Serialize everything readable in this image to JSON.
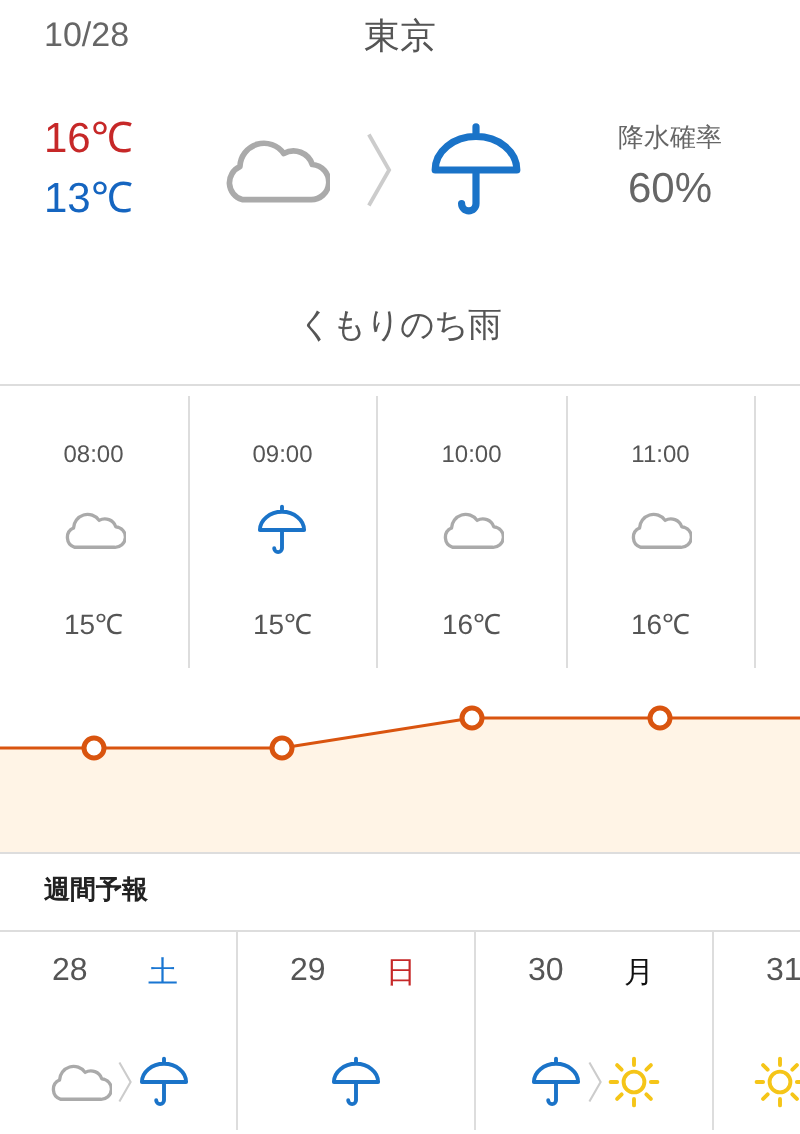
{
  "header": {
    "date": "10/28",
    "city": "東京"
  },
  "today": {
    "high": "16℃",
    "low": "13℃",
    "icons": [
      {
        "kind": "cloudy"
      },
      {
        "kind": "rain"
      }
    ],
    "precip_label": "降水確率",
    "precip_value": "60%",
    "condition": "くもりのち雨"
  },
  "hourly": [
    {
      "time": "08:00",
      "kind": "cloudy",
      "temp": "15℃"
    },
    {
      "time": "09:00",
      "kind": "rain",
      "temp": "15℃"
    },
    {
      "time": "10:00",
      "kind": "cloudy",
      "temp": "16℃"
    },
    {
      "time": "11:00",
      "kind": "cloudy",
      "temp": "16℃"
    }
  ],
  "weekly": {
    "title": "週間予報",
    "days": [
      {
        "day": "28",
        "weekday": "土",
        "color": "#1976d2",
        "icons": [
          {
            "kind": "cloudy"
          },
          {
            "kind": "rain"
          }
        ]
      },
      {
        "day": "29",
        "weekday": "日",
        "color": "#c62828",
        "icons": [
          {
            "kind": "rain"
          }
        ]
      },
      {
        "day": "30",
        "weekday": "月",
        "color": "#111111",
        "icons": [
          {
            "kind": "rain"
          },
          {
            "kind": "sunny"
          }
        ]
      },
      {
        "day": "31",
        "icons": [
          {
            "kind": "sunny"
          }
        ]
      }
    ]
  }
}
